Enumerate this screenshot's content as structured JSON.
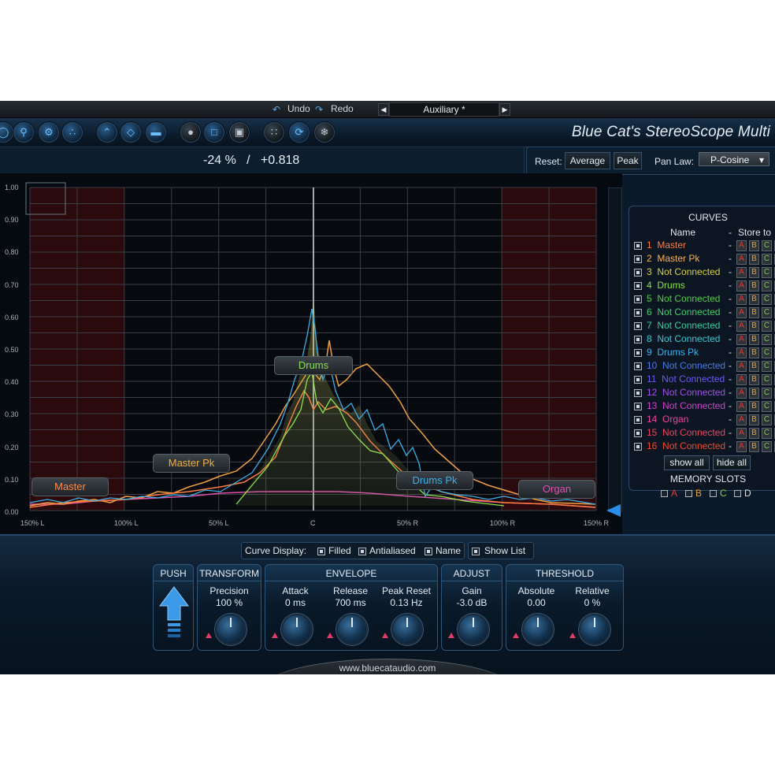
{
  "topbar": {
    "undo": "Undo",
    "redo": "Redo",
    "preset": "Auxiliary *"
  },
  "brand": "Blue Cat's StereoScope Multi",
  "readout": "-24 %   /   +0.818",
  "reset": {
    "label": "Reset:",
    "average": "Average",
    "peak": "Peak",
    "panlaw_label": "Pan Law:",
    "panlaw_value": "P-Cosine"
  },
  "scope": {
    "y_ticks": [
      "1.00",
      "0.90",
      "0.80",
      "0.70",
      "0.60",
      "0.50",
      "0.40",
      "0.30",
      "0.20",
      "0.10",
      "0.00"
    ],
    "x_ticks": [
      "150% L",
      "100% L",
      "50% L",
      "C",
      "50% R",
      "100% R",
      "150% R"
    ],
    "tags": {
      "master": "Master",
      "master_pk": "Master Pk",
      "drums": "Drums",
      "drums_pk": "Drums Pk",
      "organ": "Organ"
    }
  },
  "curves_panel": {
    "title": "CURVES",
    "col_name": "Name",
    "col_store": "Store to",
    "items": [
      {
        "num": "1",
        "name": "Master",
        "color": "#ff7a3c"
      },
      {
        "num": "2",
        "name": "Master Pk",
        "color": "#ffb040"
      },
      {
        "num": "3",
        "name": "Not Connected",
        "color": "#d8d040"
      },
      {
        "num": "4",
        "name": "Drums",
        "color": "#8ee04a"
      },
      {
        "num": "5",
        "name": "Not Connected",
        "color": "#4ad04a"
      },
      {
        "num": "6",
        "name": "Not Connected",
        "color": "#3ad070"
      },
      {
        "num": "7",
        "name": "Not Connected",
        "color": "#30d0a0"
      },
      {
        "num": "8",
        "name": "Not Connected",
        "color": "#30c8d0"
      },
      {
        "num": "9",
        "name": "Drums Pk",
        "color": "#3ab0e8"
      },
      {
        "num": "10",
        "name": "Not Connected",
        "color": "#4a7ae8"
      },
      {
        "num": "11",
        "name": "Not Connected",
        "color": "#6a5af0"
      },
      {
        "num": "12",
        "name": "Not Connected",
        "color": "#a050e8"
      },
      {
        "num": "13",
        "name": "Not Connected",
        "color": "#d040d0"
      },
      {
        "num": "14",
        "name": "Organ",
        "color": "#f040a0"
      },
      {
        "num": "15",
        "name": "Not Connected",
        "color": "#f04060"
      },
      {
        "num": "16",
        "name": "Not Connected",
        "color": "#f04a2a"
      }
    ],
    "dash": "-",
    "slots": [
      "A",
      "B",
      "C",
      "D"
    ],
    "show_all": "show all",
    "hide_all": "hide all",
    "memory_title": "MEMORY SLOTS"
  },
  "curve_display": {
    "label": "Curve Display:",
    "filled": "Filled",
    "antialiased": "Antialiased",
    "name": "Name",
    "show_list": "Show List"
  },
  "groups": {
    "push": {
      "title": "PUSH"
    },
    "transform": {
      "title": "TRANSFORM",
      "precision_label": "Precision",
      "precision_value": "100 %"
    },
    "envelope": {
      "title": "ENVELOPE",
      "attack_label": "Attack",
      "attack_value": "0 ms",
      "release_label": "Release",
      "release_value": "700 ms",
      "peakreset_label": "Peak Reset",
      "peakreset_value": "0.13 Hz"
    },
    "adjust": {
      "title": "ADJUST",
      "gain_label": "Gain",
      "gain_value": "-3.0 dB"
    },
    "threshold": {
      "title": "THRESHOLD",
      "absolute_label": "Absolute",
      "absolute_value": "0.00",
      "relative_label": "Relative",
      "relative_value": "0 %"
    }
  },
  "footer": {
    "url": "www.bluecataudio.com"
  }
}
